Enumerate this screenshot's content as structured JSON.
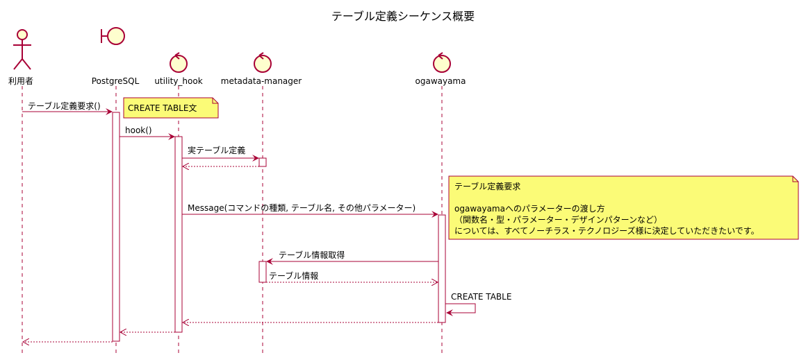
{
  "title": "テーブル定義シーケンス概要",
  "colors": {
    "participant_fill": "#FEFECE",
    "participant_stroke": "#A80036",
    "arrow": "#A80036",
    "note_fill": "#FBFB77"
  },
  "participants": [
    {
      "id": "user",
      "name": "利用者",
      "shape": "actor"
    },
    {
      "id": "pg",
      "name": "PostgreSQL",
      "shape": "boundary"
    },
    {
      "id": "uh",
      "name": "utility_hook",
      "shape": "control"
    },
    {
      "id": "mm",
      "name": "metadata-manager",
      "shape": "control"
    },
    {
      "id": "og",
      "name": "ogawayama",
      "shape": "control"
    }
  ],
  "messages": [
    {
      "label": "テーブル定義要求()"
    },
    {
      "label": "hook()"
    },
    {
      "label": "実テーブル定義"
    },
    {
      "label": ""
    },
    {
      "label": "Message(コマンドの種類, テーブル名, その他パラメーター)"
    },
    {
      "label": "テーブル情報取得"
    },
    {
      "label": "テーブル情報"
    },
    {
      "label": "CREATE TABLE"
    },
    {
      "label": ""
    },
    {
      "label": ""
    },
    {
      "label": ""
    }
  ],
  "notes": [
    {
      "lines": [
        "CREATE TABLE文"
      ]
    },
    {
      "lines": [
        "テーブル定義要求",
        "",
        "ogawayamaへのパラメーターの渡し方",
        "（関数名・型・パラメーター・デザインパターンなど）",
        "については、すべてノーチラス・テクノロジーズ様に決定していただきたいです。"
      ]
    }
  ]
}
